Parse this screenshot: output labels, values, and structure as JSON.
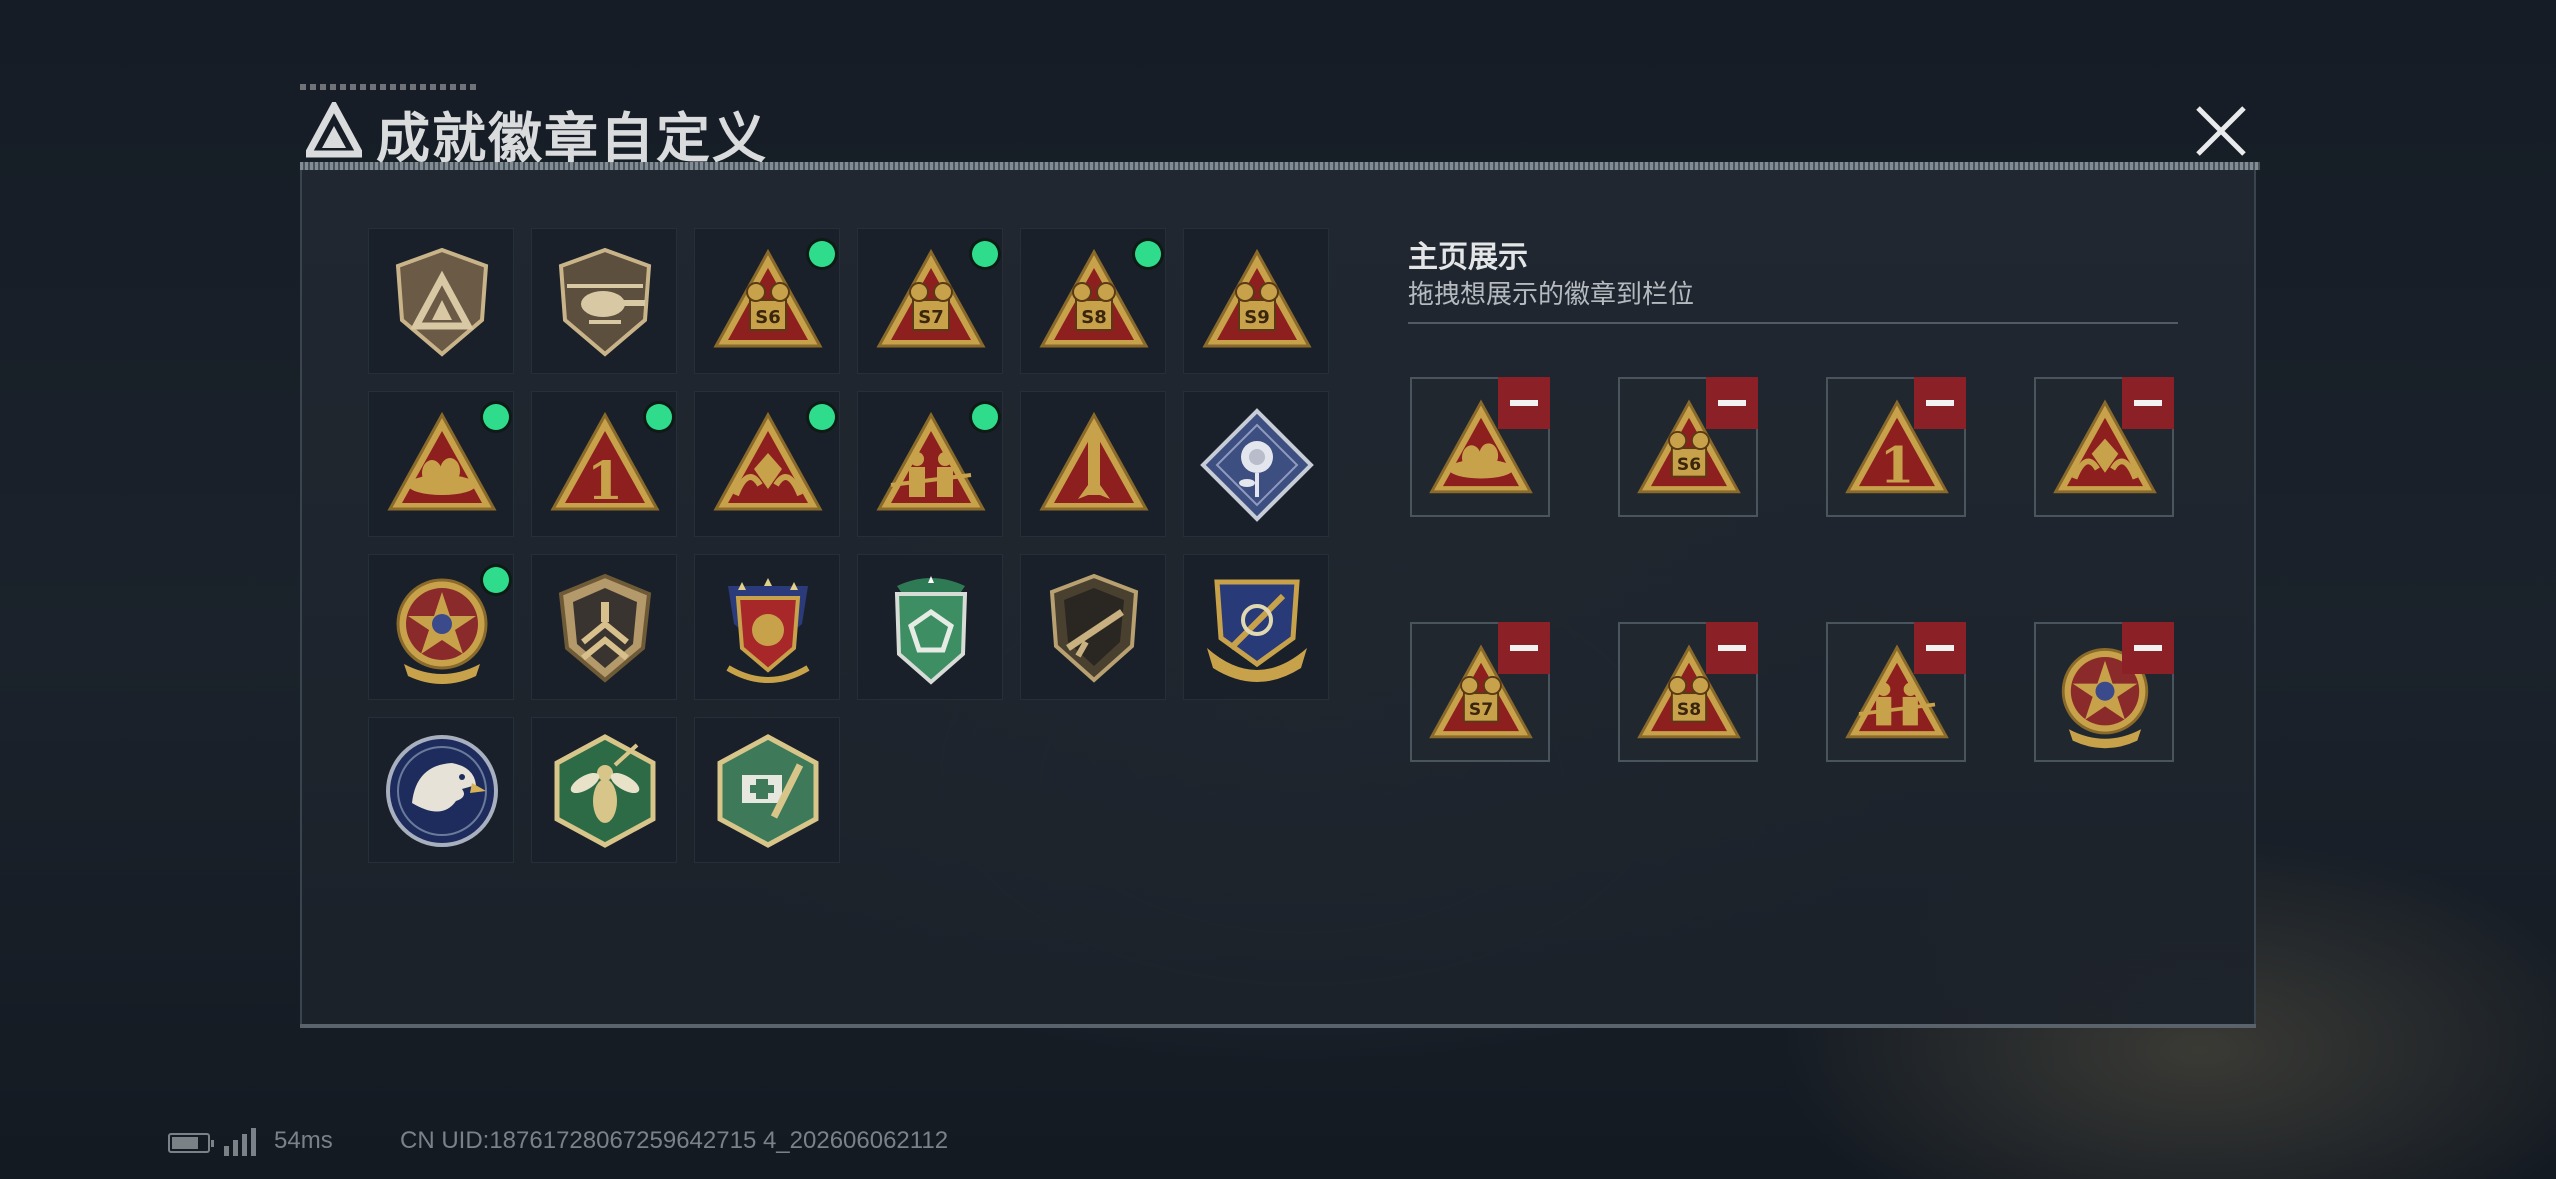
{
  "header": {
    "title": "成就徽章自定义"
  },
  "colors": {
    "accent_green": "#2fdc8c",
    "remove_red": "#8b2027",
    "gold": "#c8a24a",
    "badge_red": "#8e1f1f"
  },
  "badges": [
    {
      "icon": "shield-triangle-badge-icon",
      "is_new": false,
      "label": ""
    },
    {
      "icon": "helicopter-badge-icon",
      "is_new": false,
      "label": ""
    },
    {
      "icon": "triangle-s6-badge-icon",
      "is_new": true,
      "label": "S6"
    },
    {
      "icon": "triangle-s7-badge-icon",
      "is_new": true,
      "label": "S7"
    },
    {
      "icon": "triangle-s8-badge-icon",
      "is_new": true,
      "label": "S8"
    },
    {
      "icon": "triangle-s9-badge-icon",
      "is_new": false,
      "label": "S9"
    },
    {
      "icon": "triangle-nest-badge-icon",
      "is_new": true,
      "label": ""
    },
    {
      "icon": "triangle-number-one-badge-icon",
      "is_new": true,
      "label": "1"
    },
    {
      "icon": "triangle-hands-badge-icon",
      "is_new": true,
      "label": ""
    },
    {
      "icon": "triangle-soldiers-badge-icon",
      "is_new": true,
      "label": ""
    },
    {
      "icon": "triangle-rocket-badge-icon",
      "is_new": false,
      "label": ""
    },
    {
      "icon": "diamond-rose-badge-icon",
      "is_new": false,
      "label": ""
    },
    {
      "icon": "star-medal-badge-icon",
      "is_new": true,
      "label": ""
    },
    {
      "icon": "chevron-shield-badge-icon",
      "is_new": false,
      "label": ""
    },
    {
      "icon": "blue-red-shield-badge-icon",
      "is_new": false,
      "label": ""
    },
    {
      "icon": "green-shield-badge-icon",
      "is_new": false,
      "label": ""
    },
    {
      "icon": "rifle-shield-badge-icon",
      "is_new": false,
      "label": ""
    },
    {
      "icon": "navy-crest-badge-icon",
      "is_new": false,
      "label": ""
    },
    {
      "icon": "eagle-round-badge-icon",
      "is_new": false,
      "label": ""
    },
    {
      "icon": "wasp-hexagon-badge-icon",
      "is_new": false,
      "label": ""
    },
    {
      "icon": "medkit-hexagon-badge-icon",
      "is_new": false,
      "label": ""
    }
  ],
  "showcase": {
    "title": "主页展示",
    "subtitle": "拖拽想展示的徽章到栏位",
    "slots": [
      {
        "icon": "triangle-nest-badge-icon",
        "label": ""
      },
      {
        "icon": "triangle-s6-badge-icon",
        "label": "S6"
      },
      {
        "icon": "triangle-number-one-badge-icon",
        "label": "1"
      },
      {
        "icon": "triangle-hands-badge-icon",
        "label": ""
      },
      {
        "icon": "triangle-s7-badge-icon",
        "label": "S7"
      },
      {
        "icon": "triangle-s8-badge-icon",
        "label": "S8"
      },
      {
        "icon": "triangle-soldiers-badge-icon",
        "label": ""
      },
      {
        "icon": "star-medal-badge-icon",
        "label": ""
      }
    ]
  },
  "status_bar": {
    "ping": "54ms",
    "uid": "CN UID:18761728067259642715 4_202606062112"
  }
}
